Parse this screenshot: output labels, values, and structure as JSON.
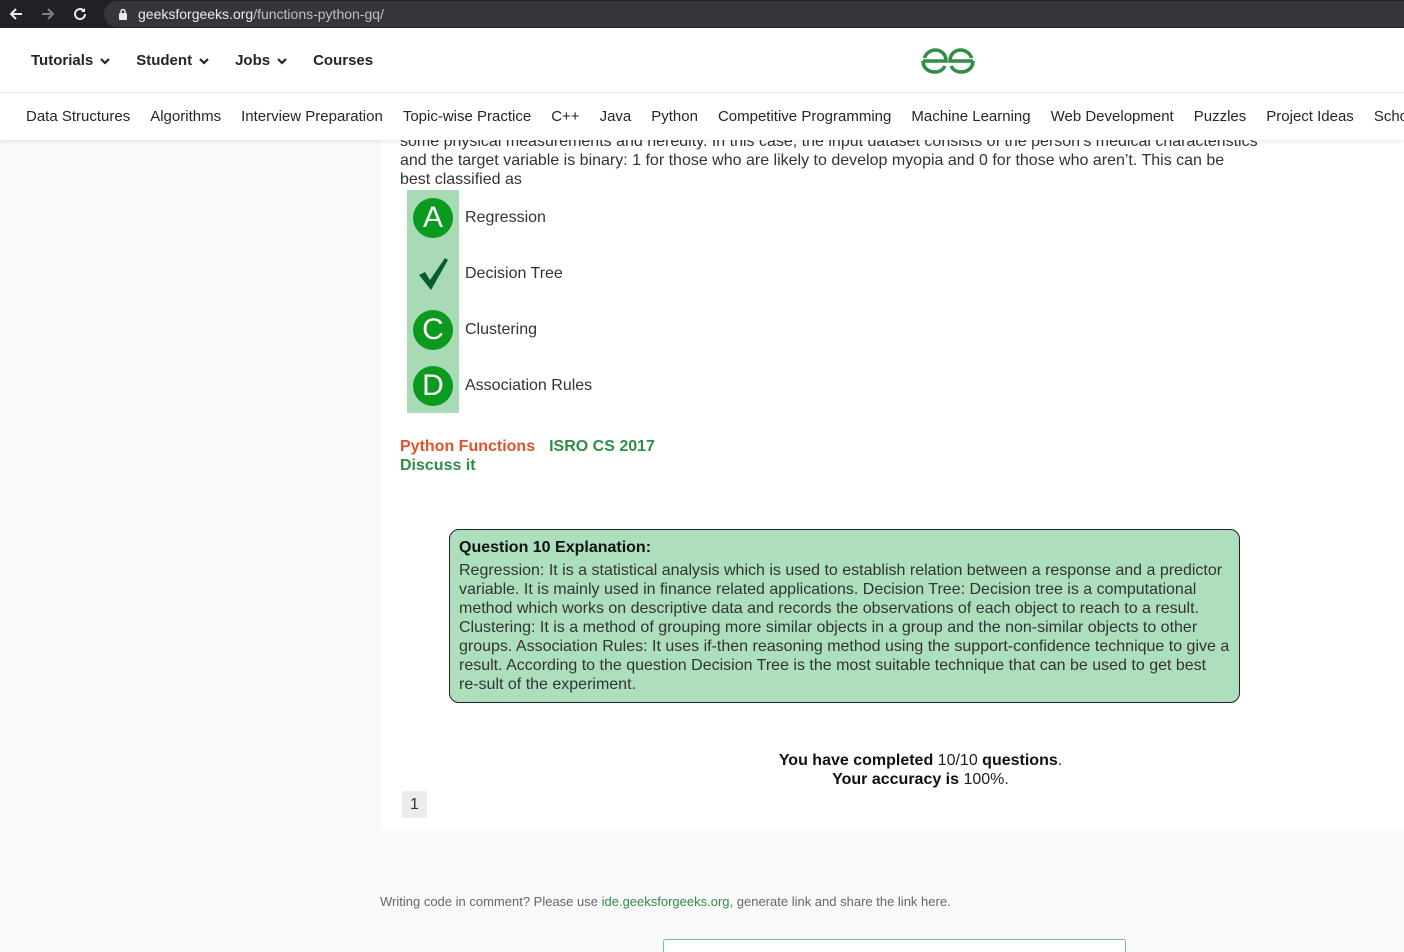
{
  "browser": {
    "url_host": "geeksforgeeks.org",
    "url_path": "/functions-python-gq/"
  },
  "header": {
    "top_nav": [
      {
        "label": "Tutorials",
        "has_dropdown": true
      },
      {
        "label": "Student",
        "has_dropdown": true
      },
      {
        "label": "Jobs",
        "has_dropdown": true
      },
      {
        "label": "Courses",
        "has_dropdown": false
      }
    ],
    "logo_color": "#2f8d46",
    "sub_nav": [
      "Data Structures",
      "Algorithms",
      "Interview Preparation",
      "Topic-wise Practice",
      "C++",
      "Java",
      "Python",
      "Competitive Programming",
      "Machine Learning",
      "Web Development",
      "Puzzles",
      "Project Ideas",
      "Scho"
    ]
  },
  "question": {
    "text_line1": "some physical measurements and heredity. In this case, the input dataset consists of the person’s medical characteristics",
    "text_line2": "and the target variable is binary: 1 for those who are likely to develop myopia and 0 for those who aren’t. This can be",
    "text_line3": "best classified as",
    "options": [
      {
        "badge": "A",
        "label": "Regression",
        "correct": false
      },
      {
        "badge": "✔",
        "label": "Decision Tree",
        "correct": true
      },
      {
        "badge": "C",
        "label": "Clustering",
        "correct": false
      },
      {
        "badge": "D",
        "label": "Association Rules",
        "correct": false
      }
    ]
  },
  "tags": {
    "topic": "Python Functions",
    "exam": "ISRO CS 2017",
    "discuss": "Discuss it"
  },
  "explanation": {
    "title": "Question 10 Explanation:",
    "body": "Regression: It is a statistical analysis which is used to establish relation between a response and a predictor variable. It is mainly used in finance related applications. Decision Tree: Decision tree is a computational method which works on descriptive data and records the observations of each object to reach to a result. Clustering: It is a method of grouping more similar objects in a group and the non-similar objects to other groups. Association Rules: It uses if-then reasoning method using the support-confidence technique to give a result. According to the question Decision Tree is the most suitable technique that can be used to get best re-sult of the experiment."
  },
  "result": {
    "completed_prefix": "You have completed",
    "completed_value": "10/10",
    "completed_suffix": "questions",
    "accuracy_prefix": "Your accuracy is",
    "accuracy_value": "100%"
  },
  "pagination": {
    "page": "1"
  },
  "footer": {
    "note_prefix": "Writing code in comment? Please use",
    "note_link": "ide.geeksforgeeks.org",
    "note_suffix": ", generate link and share the link here."
  }
}
